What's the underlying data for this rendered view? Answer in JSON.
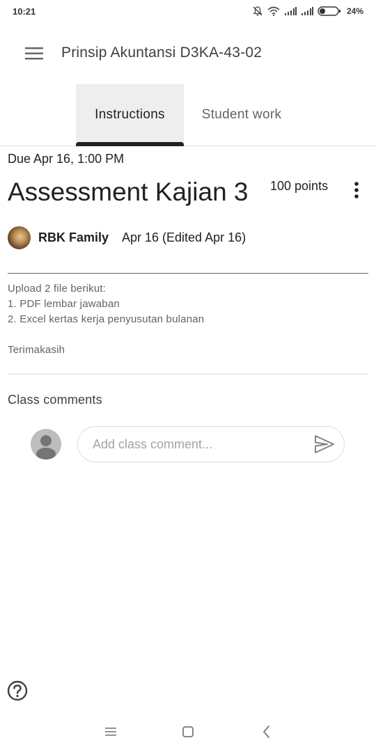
{
  "status_bar": {
    "time": "10:21",
    "battery": "24%",
    "icons": [
      "mute-icon",
      "wifi-icon",
      "signal-icon",
      "signal-icon",
      "battery-icon"
    ]
  },
  "app_bar": {
    "title": "Prinsip Akuntansi D3KA-43-02",
    "menu_icon": "hamburger-menu-icon"
  },
  "tabs": [
    {
      "label": "Instructions",
      "active": true
    },
    {
      "label": "Student work",
      "active": false
    }
  ],
  "assignment": {
    "due": "Due Apr 16, 1:00 PM",
    "title": "Assessment Kajian 3",
    "points": "100 points",
    "author": "RBK Family",
    "date": "Apr 16 (Edited Apr 16)",
    "description": [
      "Upload 2 file berikut:",
      "1. PDF lembar jawaban",
      "2. Excel kertas kerja penyusutan bulanan",
      "",
      "Terimakasih"
    ]
  },
  "comments": {
    "header": "Class comments",
    "placeholder": "Add class comment..."
  },
  "colors": {
    "text_primary": "#202124",
    "text_secondary": "#5f6368",
    "tab_active_bg": "#eeeeee",
    "divider": "#dadce0"
  }
}
